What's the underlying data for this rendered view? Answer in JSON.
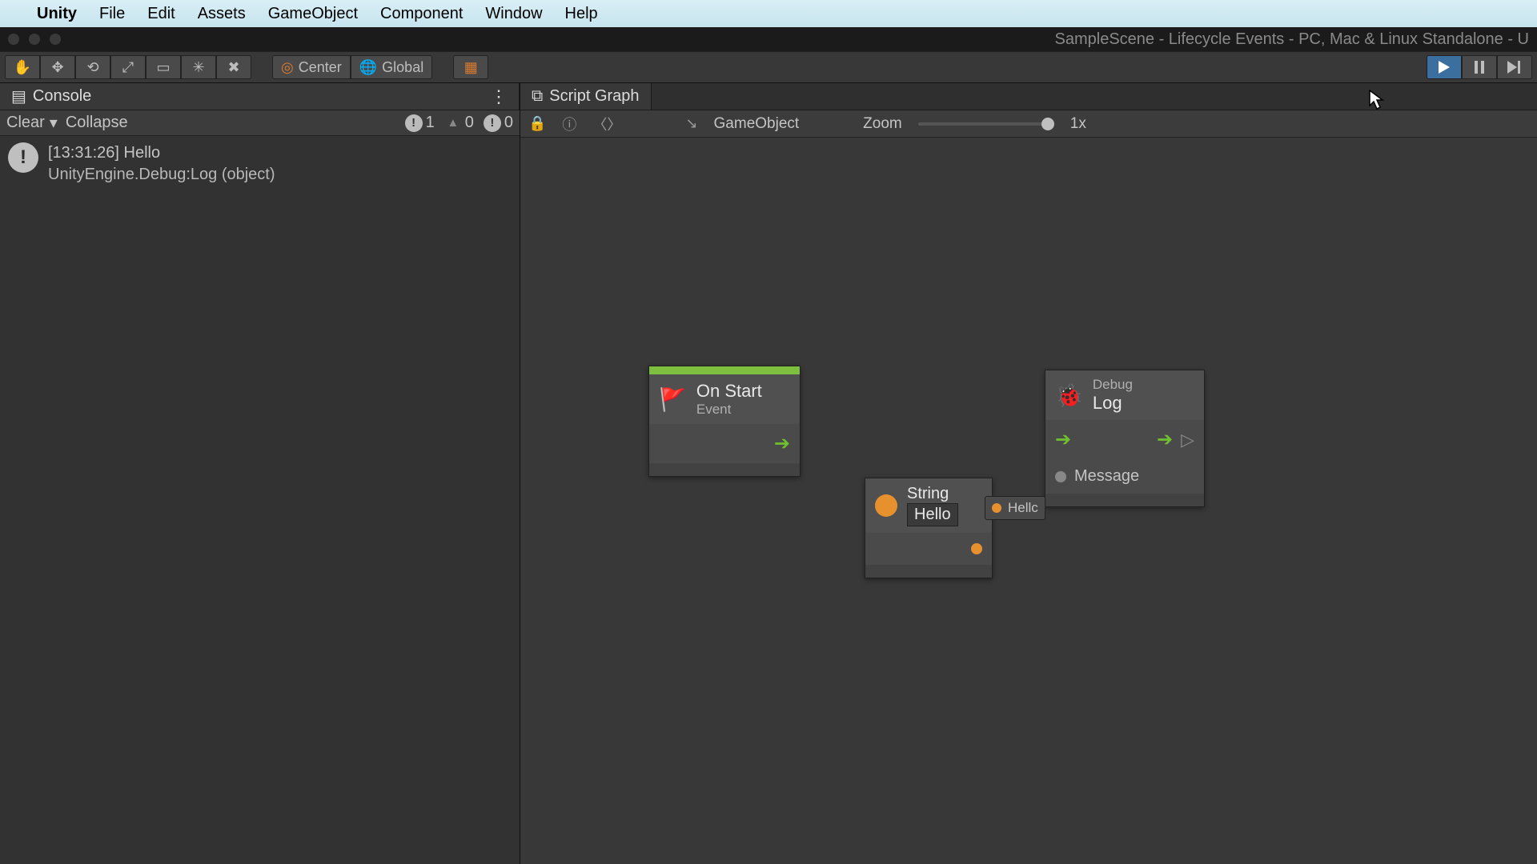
{
  "menubar": {
    "items": [
      "Unity",
      "File",
      "Edit",
      "Assets",
      "GameObject",
      "Component",
      "Window",
      "Help"
    ]
  },
  "window": {
    "title": "SampleScene - Lifecycle Events - PC, Mac & Linux Standalone - U"
  },
  "toolbar": {
    "center": "Center",
    "global": "Global"
  },
  "tabs": {
    "console": "Console",
    "scriptgraph": "Script Graph"
  },
  "console": {
    "clear": "Clear",
    "collapse": "Collapse",
    "counts": {
      "info": "1",
      "warn": "0",
      "error": "0"
    },
    "entry": {
      "line1": "[13:31:26] Hello",
      "line2": "UnityEngine.Debug:Log (object)"
    }
  },
  "graphbar": {
    "target": "GameObject",
    "zoomLabel": "Zoom",
    "zoomValue": "1x"
  },
  "nodes": {
    "onstart": {
      "title": "On Start",
      "subtitle": "Event"
    },
    "debug": {
      "category": "Debug",
      "title": "Log",
      "portLabel": "Message"
    },
    "string": {
      "type": "String",
      "value": "Hello"
    },
    "chip": {
      "text": "Hellc"
    }
  }
}
